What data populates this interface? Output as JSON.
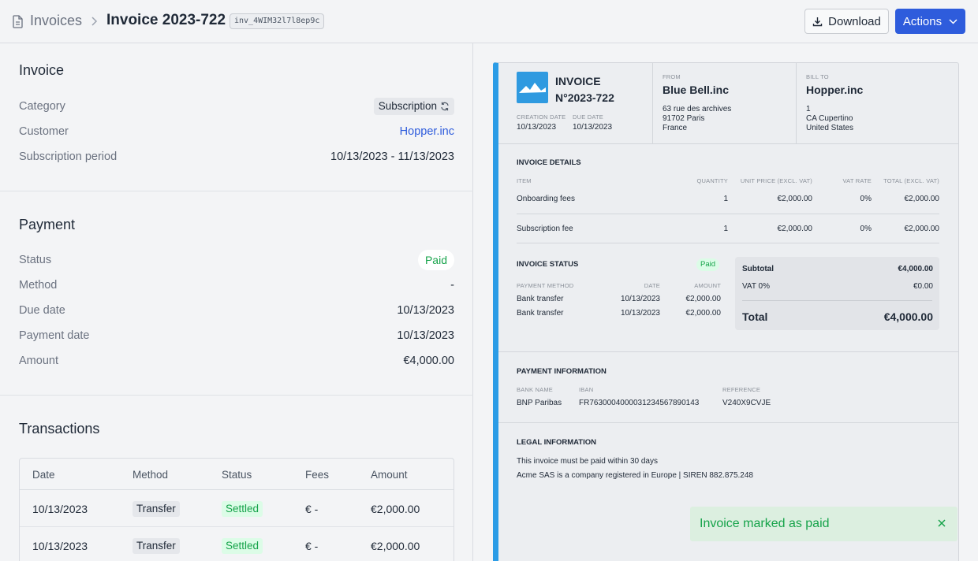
{
  "header": {
    "breadcrumb_root": "Invoices",
    "title": "Invoice 2023-722",
    "invoice_id": "inv_4WIM32l7l8ep9c",
    "download_label": "Download",
    "actions_label": "Actions"
  },
  "invoice": {
    "section_title": "Invoice",
    "category_label": "Category",
    "category_value": "Subscription",
    "customer_label": "Customer",
    "customer_value": "Hopper.inc",
    "period_label": "Subscription period",
    "period_value": "10/13/2023 - 11/13/2023"
  },
  "payment": {
    "section_title": "Payment",
    "status_label": "Status",
    "status_value": "Paid",
    "method_label": "Method",
    "method_value": "-",
    "due_label": "Due date",
    "due_value": "10/13/2023",
    "paydate_label": "Payment date",
    "paydate_value": "10/13/2023",
    "amount_label": "Amount",
    "amount_value": "€4,000.00"
  },
  "transactions": {
    "section_title": "Transactions",
    "headers": [
      "Date",
      "Method",
      "Status",
      "Fees",
      "Amount"
    ],
    "rows": [
      {
        "date": "10/13/2023",
        "method": "Transfer",
        "status": "Settled",
        "fees": "€ -",
        "amount": "€2,000.00"
      },
      {
        "date": "10/13/2023",
        "method": "Transfer",
        "status": "Settled",
        "fees": "€ -",
        "amount": "€2,000.00"
      }
    ]
  },
  "document": {
    "title_line1": "INVOICE",
    "title_line2": "N°2023-722",
    "creation_label": "CREATION DATE",
    "creation_value": "10/13/2023",
    "due_label": "DUE DATE",
    "due_value": "10/13/2023",
    "from_label": "FROM",
    "from_name": "Blue Bell.inc",
    "from_addr1": "63 rue des archives",
    "from_addr2": "91702 Paris",
    "from_addr3": "France",
    "bill_label": "BILL TO",
    "bill_name": "Hopper.inc",
    "bill_addr1": "1",
    "bill_addr2": "CA Cupertino",
    "bill_addr3": "United States",
    "details_title": "INVOICE DETAILS",
    "details_headers": {
      "item": "ITEM",
      "qty": "QUANTITY",
      "unit": "UNIT PRICE (EXCL. VAT)",
      "vat": "VAT RATE",
      "total": "TOTAL (EXCL. VAT)"
    },
    "lines": [
      {
        "item": "Onboarding fees",
        "qty": "1",
        "unit": "€2,000.00",
        "vat": "0%",
        "total": "€2,000.00"
      },
      {
        "item": "Subscription fee",
        "qty": "1",
        "unit": "€2,000.00",
        "vat": "0%",
        "total": "€2,000.00"
      }
    ],
    "status_title": "INVOICE STATUS",
    "status_badge": "Paid",
    "pay_headers": {
      "method": "PAYMENT METHOD",
      "date": "DATE",
      "amount": "AMOUNT"
    },
    "payments": [
      {
        "method": "Bank transfer",
        "date": "10/13/2023",
        "amount": "€2,000.00"
      },
      {
        "method": "Bank transfer",
        "date": "10/13/2023",
        "amount": "€2,000.00"
      }
    ],
    "subtotal_label": "Subtotal",
    "subtotal_value": "€4,000.00",
    "vat_label": "VAT 0%",
    "vat_value": "€0.00",
    "total_label": "Total",
    "total_value": "€4,000.00",
    "payinfo_title": "PAYMENT INFORMATION",
    "bank_label": "BANK NAME",
    "bank_value": "BNP Paribas",
    "iban_label": "IBAN",
    "iban_value": "FR7630004000031234567890143",
    "ref_label": "REFERENCE",
    "ref_value": "V240X9CVJE",
    "legal_title": "LEGAL INFORMATION",
    "legal_line1": "This invoice must be paid within 30 days",
    "legal_line2": "Acme SAS is a company registered in Europe | SIREN 882.875.248"
  },
  "toast": {
    "message": "Invoice marked as paid"
  },
  "colors": {
    "accent": "#2e5cdc",
    "success": "#16a34a",
    "doc_stripe": "#2b9ce6"
  }
}
